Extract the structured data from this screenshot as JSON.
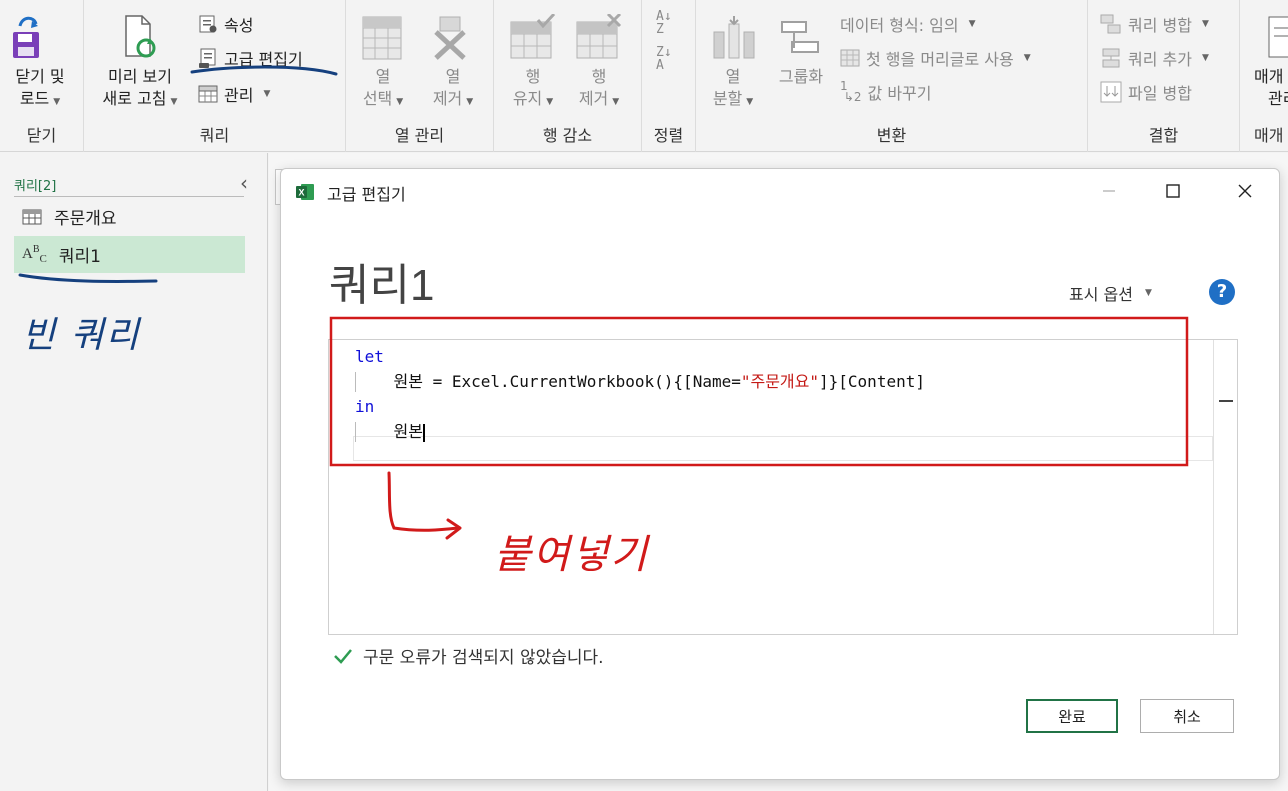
{
  "ribbon": {
    "groups": {
      "close": {
        "label": "닫기",
        "close_load_line1": "닫기 및",
        "close_load_line2": "로드"
      },
      "query": {
        "label": "쿼리",
        "preview_line1": "미리 보기",
        "preview_line2": "새로 고침",
        "properties": "속성",
        "advanced_editor": "고급 편집기",
        "manage": "관리"
      },
      "manage_columns": {
        "label": "열 관리",
        "choose_line1": "열",
        "choose_line2": "선택",
        "remove_line1": "열",
        "remove_line2": "제거"
      },
      "reduce_rows": {
        "label": "행 감소",
        "keep_line1": "행",
        "keep_line2": "유지",
        "remove_line1": "행",
        "remove_line2": "제거"
      },
      "sort": {
        "label": "정렬"
      },
      "transform": {
        "label": "변환",
        "split_line1": "열",
        "split_line2": "분할",
        "group_by": "그룹화",
        "data_type": "데이터 형식: 임의",
        "first_row_header": "첫 행을 머리글로 사용",
        "replace_values": "값 바꾸기"
      },
      "combine": {
        "label": "결합",
        "merge": "쿼리 병합",
        "append": "쿼리 추가",
        "combine_files": "파일 병합"
      },
      "params": {
        "label": "매개",
        "line1": "매개",
        "line2": "관리"
      }
    }
  },
  "query_pane": {
    "title": "쿼리[2]",
    "items": [
      {
        "label": "주문개요",
        "icon": "table-icon"
      },
      {
        "label": "쿼리1",
        "icon": "abc-text-icon"
      }
    ]
  },
  "dialog": {
    "title": "고급 편집기",
    "query_name": "쿼리1",
    "display_options": "표시 옵션",
    "help": "?",
    "code": {
      "line1_kw": "let",
      "line2_pre": "    원본 = Excel.CurrentWorkbook(){[Name=",
      "line2_str": "\"주문개요\"",
      "line2_post": "]}[Content]",
      "line3_kw": "in",
      "line4": "    원본"
    },
    "status": "구문 오류가 검색되지 않았습니다.",
    "ok": "완료",
    "cancel": "취소"
  },
  "annotations": {
    "blank_query": "빈 쿼리",
    "paste": "붙여넣기",
    "colors": {
      "blue_ink": "#15407e",
      "red_ink": "#d11a1a"
    }
  }
}
